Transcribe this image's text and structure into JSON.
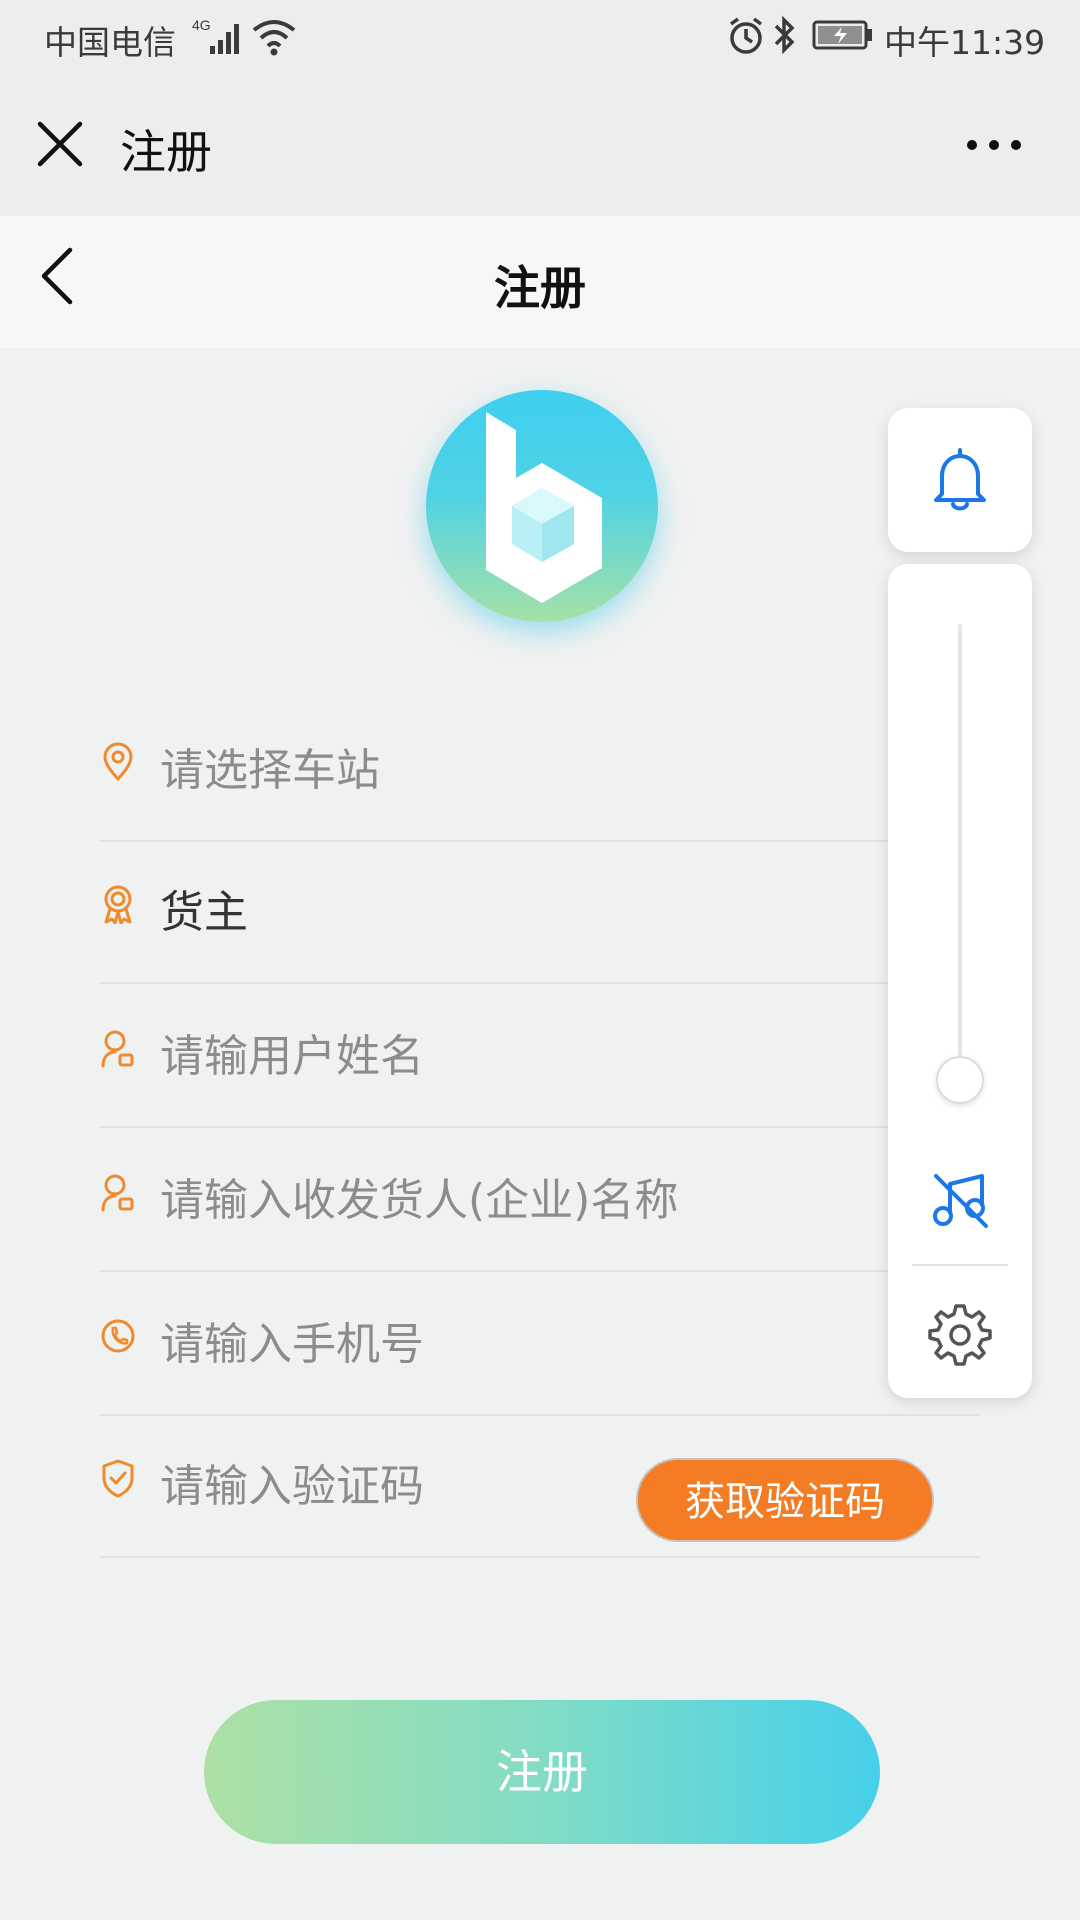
{
  "status_bar": {
    "carrier": "中国电信",
    "network_badge": "4G",
    "time": "中午11:39"
  },
  "top_bar": {
    "title": "注册"
  },
  "nav": {
    "title": "注册"
  },
  "form": {
    "station": {
      "placeholder": "请选择车站",
      "icon": "location-pin-icon"
    },
    "role": {
      "value": "货主",
      "icon": "badge-icon"
    },
    "username": {
      "placeholder": "请输用户姓名",
      "icon": "user-icon"
    },
    "company": {
      "placeholder": "请输入收发货人(企业)名称",
      "icon": "user-icon"
    },
    "phone": {
      "placeholder": "请输入手机号",
      "icon": "phone-icon"
    },
    "code": {
      "placeholder": "请输入验证码",
      "icon": "shield-check-icon"
    },
    "get_code_label": "获取验证码",
    "submit_label": "注册"
  },
  "colors": {
    "accent_orange": "#f47c24",
    "accent_blue": "#1c78e6",
    "gradient_start": "#ade0a4",
    "gradient_end": "#46d0ea"
  },
  "panel": {
    "volume_fraction": 0.05
  }
}
